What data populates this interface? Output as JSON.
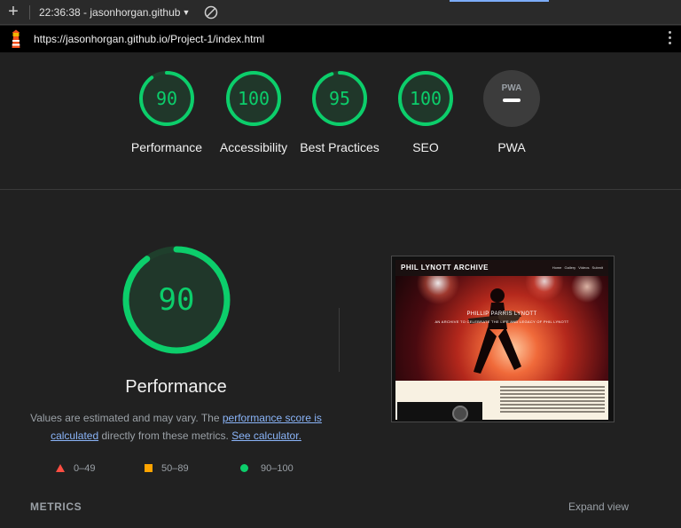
{
  "toolbar": {
    "add_icon": "plus-icon",
    "report_label": "22:36:38 - jasonhorgan.github",
    "clear_icon": "block-icon"
  },
  "urlbar": {
    "url": "https://jasonhorgan.github.io/Project-1/index.html",
    "logo_icon": "lighthouse-icon",
    "menu_icon": "kebab-menu-icon"
  },
  "gauges": [
    {
      "label": "Performance",
      "score": "90",
      "value": 0.9,
      "color": "#0cce6b"
    },
    {
      "label": "Accessibility",
      "score": "100",
      "value": 1.0,
      "color": "#0cce6b"
    },
    {
      "label": "Best Practices",
      "score": "95",
      "value": 0.95,
      "color": "#0cce6b"
    },
    {
      "label": "SEO",
      "score": "100",
      "value": 1.0,
      "color": "#0cce6b"
    },
    {
      "label": "PWA",
      "score": "",
      "value": 0,
      "color": "#9aa0a6",
      "badge": "PWA"
    }
  ],
  "performance": {
    "score": "90",
    "value": 0.9,
    "title": "Performance",
    "desc_prefix": "Values are estimated and may vary. The ",
    "link_score": "performance score is calculated",
    "desc_middle": " directly from these metrics. ",
    "link_calc": "See calculator."
  },
  "legend": {
    "fail": "0–49",
    "average": "50–89",
    "pass": "90–100"
  },
  "screenshot": {
    "brand": "PHIL LYNOTT ARCHIVE",
    "nav": "Home Gallery Videos Submit",
    "hero_title": "PHILLIP PARRIS LYNOTT",
    "hero_subtitle": "AN ARCHIVE TO CELEBRATE THE LIFE AND LEGACY OF PHIL LYNOTT"
  },
  "metrics": {
    "heading": "METRICS",
    "expand": "Expand view"
  },
  "colors": {
    "pass": "#0cce6b",
    "average": "#ffa400",
    "fail": "#ff4e42",
    "link": "#8ab4f8"
  }
}
